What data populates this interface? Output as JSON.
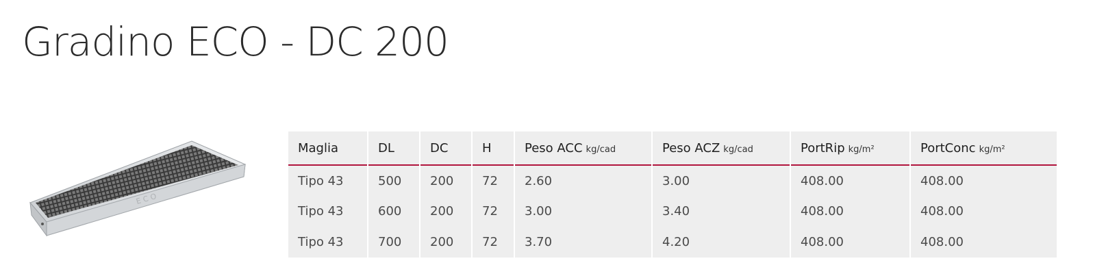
{
  "page": {
    "title": "Gradino ECO - DC 200"
  },
  "product_image": {
    "description_icon": "grating-step-image",
    "engraving": "E C O"
  },
  "table": {
    "columns": [
      {
        "label": "Maglia",
        "unit": ""
      },
      {
        "label": "DL",
        "unit": ""
      },
      {
        "label": "DC",
        "unit": ""
      },
      {
        "label": "H",
        "unit": ""
      },
      {
        "label": "Peso ACC",
        "unit": "kg/cad"
      },
      {
        "label": "Peso ACZ",
        "unit": "kg/cad"
      },
      {
        "label": "PortRip",
        "unit": "kg/m²"
      },
      {
        "label": "PortConc",
        "unit": "kg/m²"
      }
    ],
    "rows": [
      [
        "Tipo 43",
        "500",
        "200",
        "72",
        "2.60",
        "3.00",
        "408.00",
        "408.00"
      ],
      [
        "Tipo 43",
        "600",
        "200",
        "72",
        "3.00",
        "3.40",
        "408.00",
        "408.00"
      ],
      [
        "Tipo 43",
        "700",
        "200",
        "72",
        "3.70",
        "4.20",
        "408.00",
        "408.00"
      ]
    ],
    "header_underline_color": "#b1153d",
    "background_color": "#eeeeee"
  }
}
